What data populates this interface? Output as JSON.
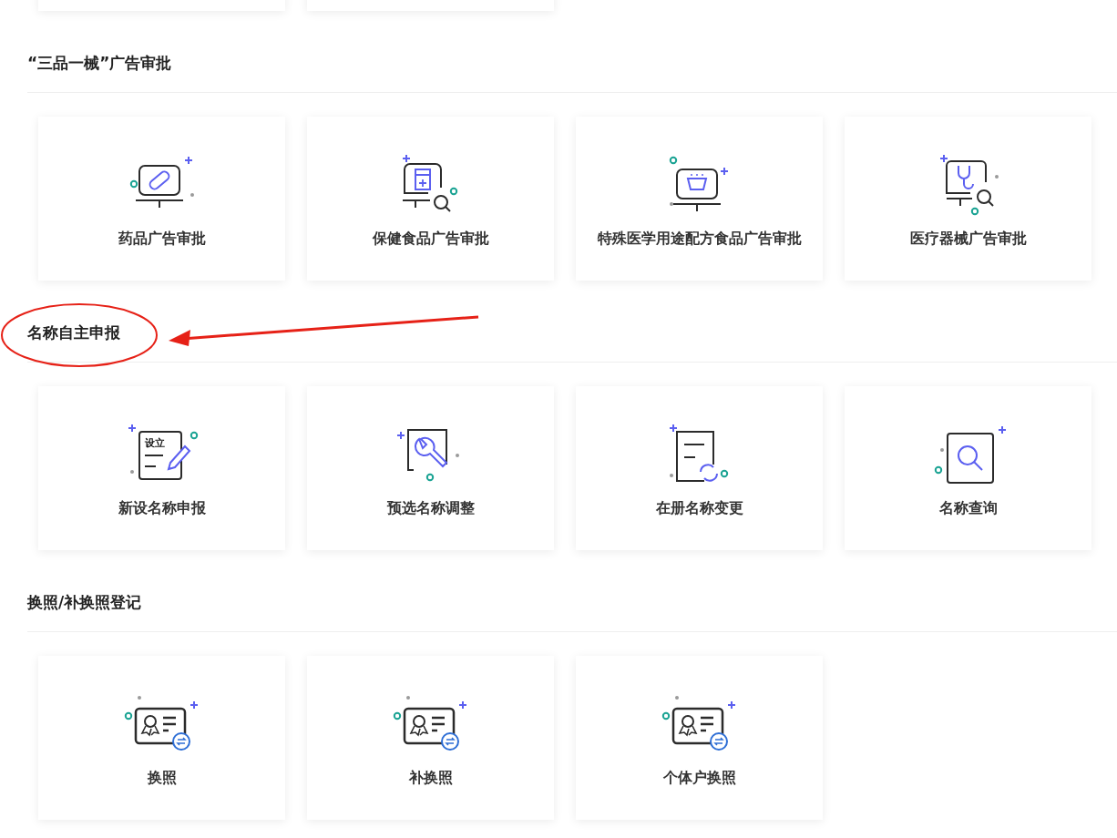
{
  "sections": [
    {
      "title": "“三品一械”广告审批",
      "cards": [
        {
          "label": "药品广告审批"
        },
        {
          "label": "保健食品广告审批"
        },
        {
          "label": "特殊医学用途配方食品广告审批"
        },
        {
          "label": "医疗器械广告审批"
        }
      ]
    },
    {
      "title": "名称自主申报",
      "annotated": true,
      "cards": [
        {
          "label": "新设名称申报",
          "icon_text": "设立"
        },
        {
          "label": "预选名称调整"
        },
        {
          "label": "在册名称变更"
        },
        {
          "label": "名称查询"
        }
      ]
    },
    {
      "title": "换照/补换照登记",
      "cards": [
        {
          "label": "换照"
        },
        {
          "label": "补换照"
        },
        {
          "label": "个体户换照"
        }
      ]
    }
  ]
}
